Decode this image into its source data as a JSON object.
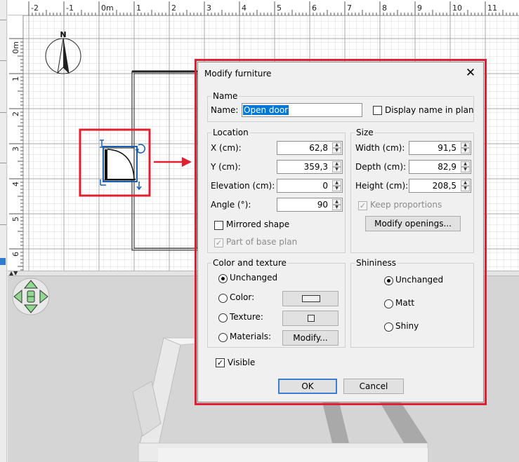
{
  "plan": {
    "ruler_top_labels": [
      "-2",
      "-1",
      "0m",
      "1",
      "2",
      "3",
      "4",
      "5",
      "6",
      "7",
      "8",
      "9",
      "10",
      "11"
    ],
    "ruler_left_labels": [
      "0m",
      "1",
      "2",
      "3",
      "4",
      "5",
      "6"
    ],
    "compass_letter": "N"
  },
  "dialog": {
    "title": "Modify furniture",
    "close_icon": "close-icon",
    "name_group": {
      "title": "Name",
      "name_label": "Name:",
      "name_value": "Open door",
      "display_name_label": "Display name in plan",
      "display_name_checked": false
    },
    "location_group": {
      "title": "Location",
      "x_label": "X (cm):",
      "x_value": "62,8",
      "y_label": "Y (cm):",
      "y_value": "359,3",
      "elevation_label": "Elevation (cm):",
      "elevation_value": "0",
      "angle_label": "Angle (°):",
      "angle_value": "90",
      "mirrored_label": "Mirrored shape",
      "mirrored_checked": false,
      "base_plan_label": "Part of base plan",
      "base_plan_checked": true
    },
    "size_group": {
      "title": "Size",
      "width_label": "Width (cm):",
      "width_value": "91,5",
      "depth_label": "Depth (cm):",
      "depth_value": "82,9",
      "height_label": "Height (cm):",
      "height_value": "208,5",
      "keep_proportions_label": "Keep proportions",
      "keep_proportions_checked": true,
      "modify_openings_label": "Modify openings..."
    },
    "color_group": {
      "title": "Color and texture",
      "unchanged_label": "Unchanged",
      "color_label": "Color:",
      "texture_label": "Texture:",
      "materials_label": "Materials:",
      "modify_label": "Modify...",
      "selected": "Unchanged"
    },
    "shininess_group": {
      "title": "Shininess",
      "unchanged_label": "Unchanged",
      "matt_label": "Matt",
      "shiny_label": "Shiny",
      "selected": "Unchanged"
    },
    "visible_label": "Visible",
    "visible_checked": true,
    "ok_label": "OK",
    "cancel_label": "Cancel"
  },
  "colors": {
    "annotation_red": "#e02030",
    "selection_blue": "#0078d7",
    "nav_green": "#8fd88f"
  }
}
